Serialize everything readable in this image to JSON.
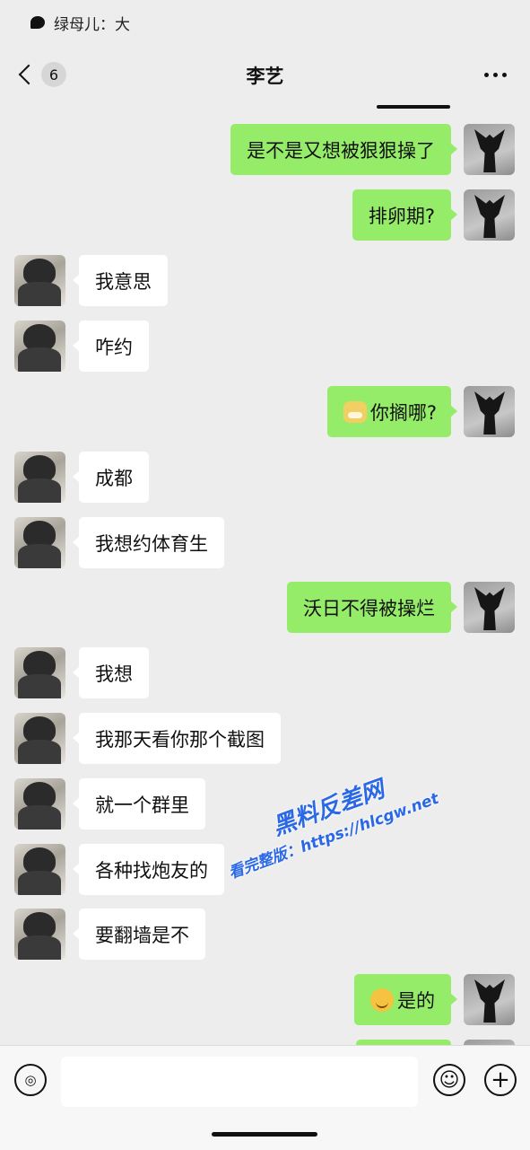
{
  "status": {
    "text": "绿母儿：大"
  },
  "header": {
    "unread_count": "6",
    "title": "李艺"
  },
  "messages": [
    {
      "side": "me",
      "text": "是不是又想被狠狠操了"
    },
    {
      "side": "me",
      "text": "排卵期?"
    },
    {
      "side": "them",
      "text": "我意思"
    },
    {
      "side": "them",
      "text": "咋约"
    },
    {
      "side": "me",
      "text": "你搁哪?",
      "emoji": "doge-emoji"
    },
    {
      "side": "them",
      "text": "成都"
    },
    {
      "side": "them",
      "text": "我想约体育生"
    },
    {
      "side": "me",
      "text": "沃日不得被操烂"
    },
    {
      "side": "them",
      "text": "我想"
    },
    {
      "side": "them",
      "text": "我那天看你那个截图"
    },
    {
      "side": "them",
      "text": "就一个群里"
    },
    {
      "side": "them",
      "text": "各种找炮友的"
    },
    {
      "side": "them",
      "text": "要翻墙是不"
    },
    {
      "side": "me",
      "text": "是的",
      "emoji": "smile-emoji"
    }
  ],
  "watermark": {
    "line1": "黑料反差网",
    "line2": "看完整版：https://hlcgw.net"
  },
  "input": {
    "placeholder": ""
  },
  "colors": {
    "bubble_me": "#95ec69",
    "bubble_them": "#ffffff",
    "background": "#ededed"
  }
}
